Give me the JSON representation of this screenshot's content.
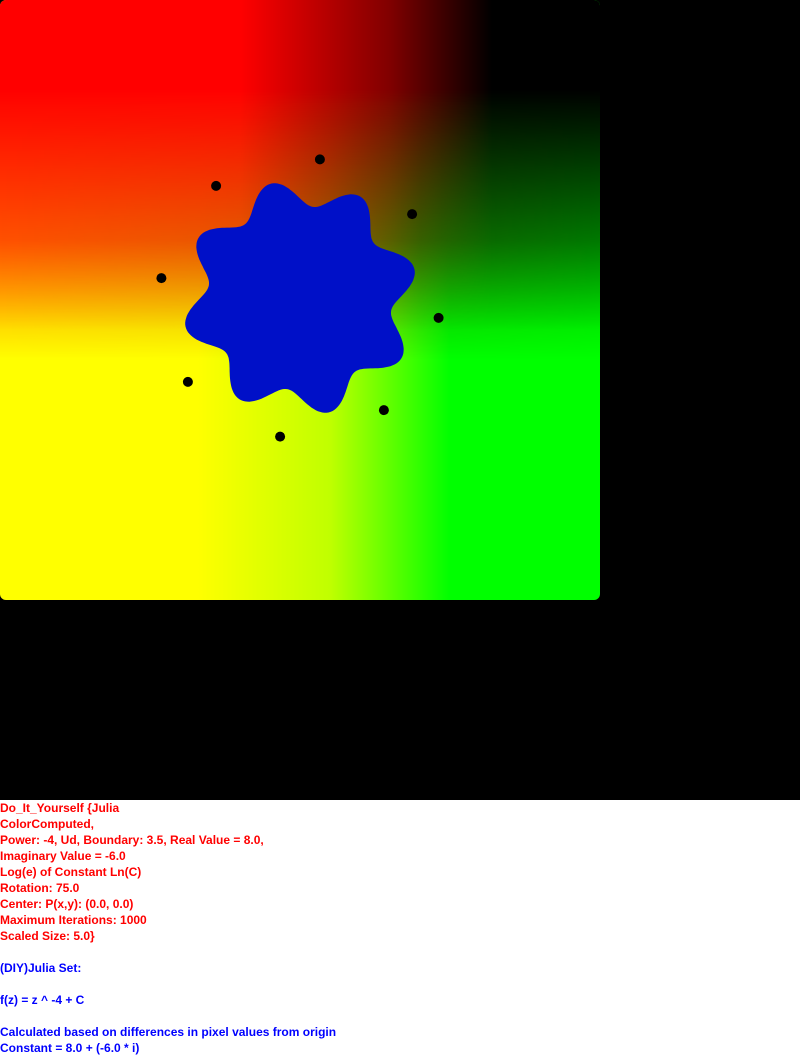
{
  "colors": {
    "background": "#000000",
    "set_fill": "#0010c8",
    "dots": "#000000",
    "gradient_red": "#ff0000",
    "gradient_yellow": "#ffff00",
    "gradient_green": "#00ff00",
    "params_text": "#ff0000",
    "formula_text": "#0000ff"
  },
  "parameters": {
    "lines": [
      "Do_It_Yourself {Julia",
      "ColorComputed,",
      "Power: -4, Ud, Boundary: 3.5, Real Value = 8.0,",
      "Imaginary Value = -6.0",
      "Log(e) of Constant Ln(C)",
      "Rotation: 75.0",
      "Center: P(x,y): (0.0, 0.0)",
      "Maximum Iterations: 1000",
      "Scaled Size: 5.0}"
    ]
  },
  "formula": {
    "title": "(DIY)Julia Set:",
    "equation": "f(z) = z ^ -4 + C",
    "note": "Calculated based on differences in pixel values from origin",
    "constant": "Constant = 8.0 + (-6.0 * i)"
  }
}
